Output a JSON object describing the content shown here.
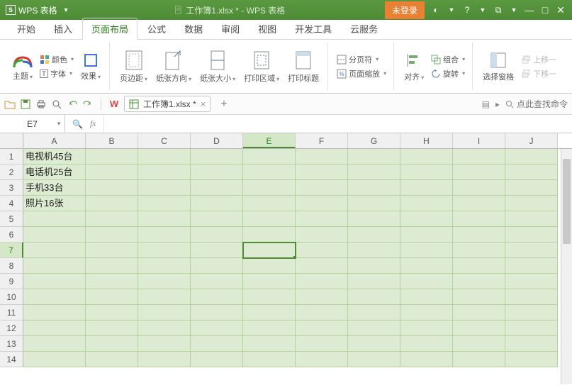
{
  "app": {
    "name": "WPS 表格",
    "title_doc": "工作簿1.xlsx * - WPS 表格",
    "login": "未登录"
  },
  "menu": {
    "items": [
      "开始",
      "插入",
      "页面布局",
      "公式",
      "数据",
      "审阅",
      "视图",
      "开发工具",
      "云服务"
    ],
    "active": 2
  },
  "ribbon": {
    "theme": "主题",
    "color": "颜色",
    "font": "字体",
    "effect": "效果",
    "margins": "页边距",
    "orientation": "纸张方向",
    "size": "纸张大小",
    "printarea": "打印区域",
    "printtitles": "打印标题",
    "breaks": "分页符",
    "scale": "页面缩放",
    "align": "对齐",
    "rotate": "旋转",
    "group": "组合",
    "selectpane": "选择窗格",
    "moveup": "上移一",
    "movedown": "下移一"
  },
  "qat": {
    "doc": "工作簿1.xlsx *",
    "search": "点此查找命令"
  },
  "formula": {
    "namebox": "E7",
    "fx": "fx"
  },
  "columns": [
    "A",
    "B",
    "C",
    "D",
    "E",
    "F",
    "G",
    "H",
    "I",
    "J"
  ],
  "rows": [
    1,
    2,
    3,
    4,
    5,
    6,
    7,
    8,
    9,
    10,
    11,
    12,
    13,
    14
  ],
  "cells": {
    "A1": "电视机45台",
    "A2": "电话机25台",
    "A3": "手机33台",
    "A4": "照片16张"
  },
  "active_cell": "E7",
  "selected_col": 4,
  "selected_row": 6
}
